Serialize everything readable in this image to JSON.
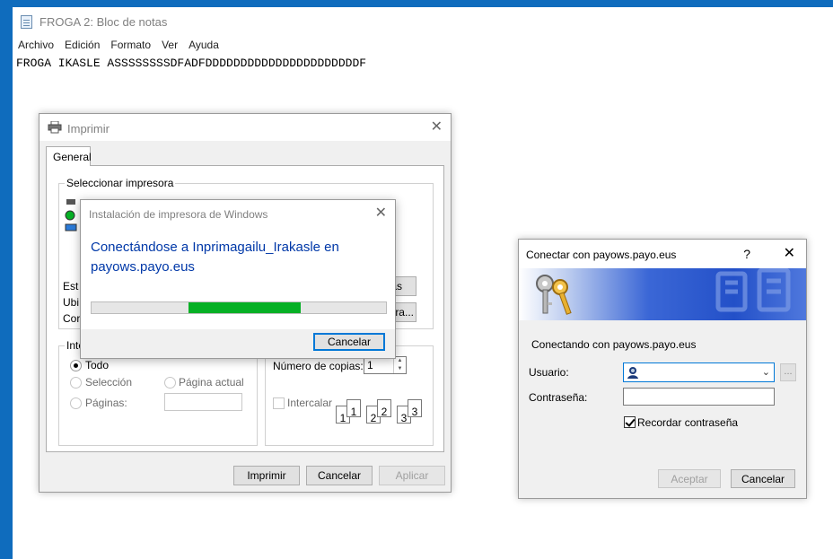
{
  "notepad": {
    "title": "FROGA 2: Bloc de notas",
    "menu": [
      "Archivo",
      "Edición",
      "Formato",
      "Ver",
      "Ayuda"
    ],
    "text": "FROGA IKASLE ASSSSSSSSDFADFDDDDDDDDDDDDDDDDDDDDDDF"
  },
  "print_dialog": {
    "title": "Imprimir",
    "tab": "General",
    "select_printer_label": "Seleccionar impresora",
    "status_label_partial": "Est",
    "location_label_partial": "Ubi",
    "comment_label_partial": "Cor",
    "preferences_btn_partial": "as",
    "find_printer_btn_partial": "sora...",
    "range_group_partial": "Inte",
    "range_all": "Todo",
    "range_selection": "Selección",
    "range_current": "Página actual",
    "range_pages": "Páginas:",
    "copies_label": "Número de copias:",
    "copies_value": "1",
    "collate_label": "Intercalar",
    "collate_pages": [
      "1",
      "1",
      "2",
      "2",
      "3",
      "3"
    ],
    "print_button": "Imprimir",
    "cancel_button": "Cancelar",
    "apply_button": "Aplicar"
  },
  "install_dialog": {
    "title": "Instalación de impresora de Windows",
    "message": "Conectándose a Inprimagailu_Irakasle en payows.payo.eus",
    "progress": {
      "start": 0.33,
      "end": 0.71
    },
    "cancel_button": "Cancelar"
  },
  "connect_dialog": {
    "title": "Conectar con payows.payo.eus",
    "help": "?",
    "message": "Conectando con payows.payo.eus",
    "user_label": "Usuario:",
    "user_value": "",
    "password_label": "Contraseña:",
    "remember_label": "Recordar contraseña",
    "remember_checked": true,
    "accept_button": "Aceptar",
    "cancel_button": "Cancelar",
    "ellipsis": "..."
  },
  "colors": {
    "accent": "#0078d7",
    "progress": "#06b025",
    "install_text": "#0038a8",
    "desktop": "#0f6cbd"
  }
}
